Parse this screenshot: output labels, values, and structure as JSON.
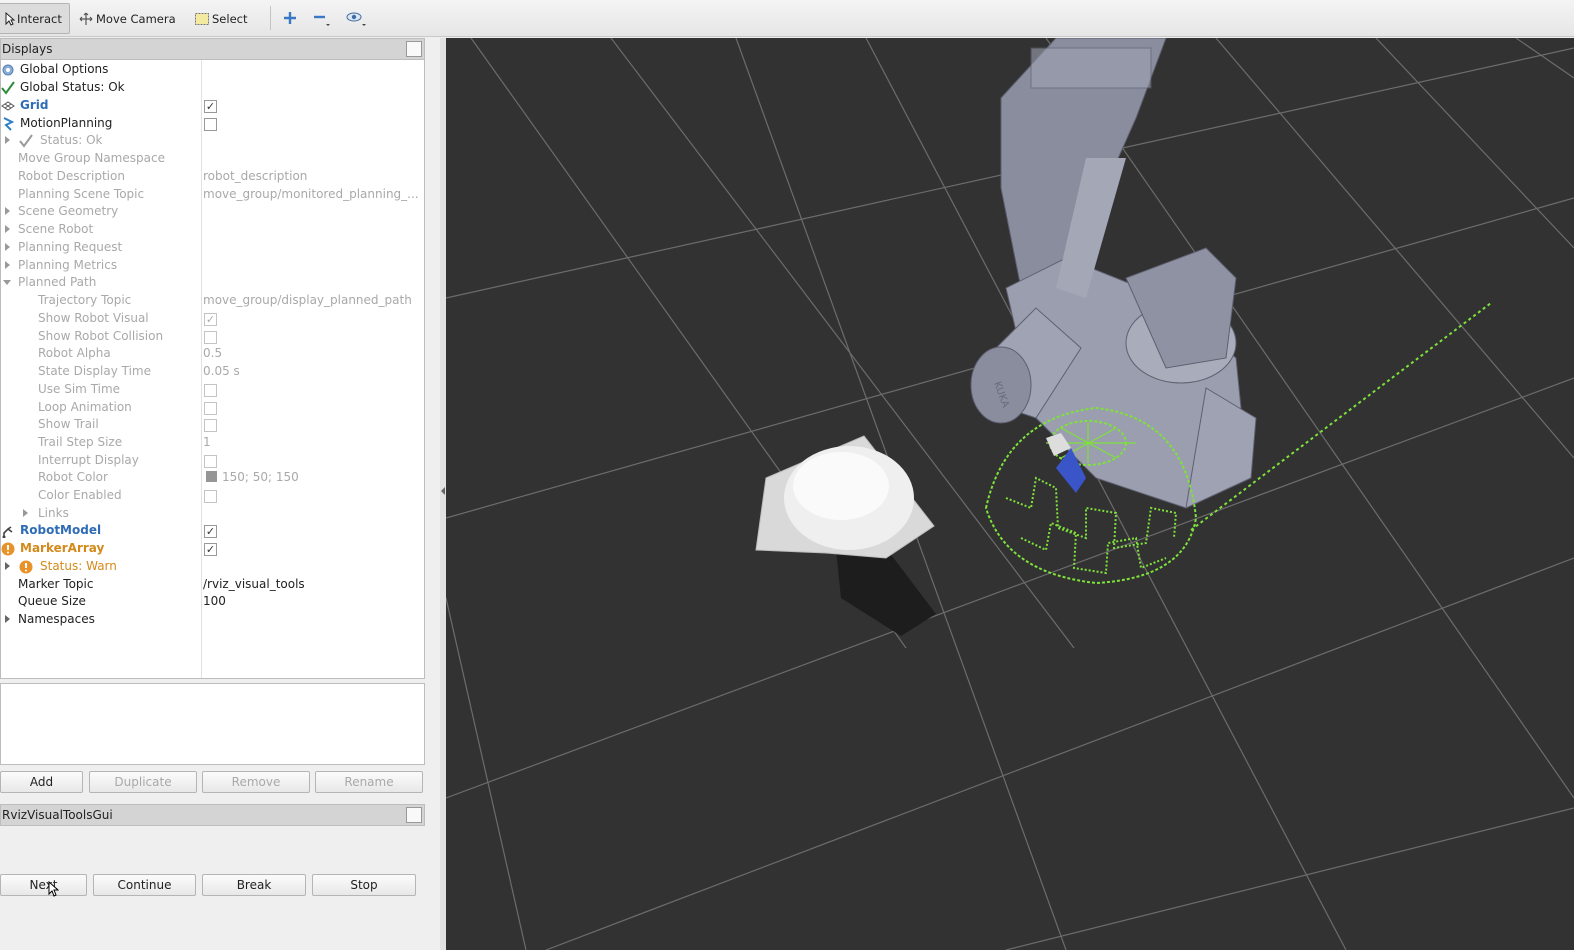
{
  "toolbar": {
    "interact": "Interact",
    "move_camera": "Move Camera",
    "select": "Select",
    "add_icon": "plus-icon",
    "remove_icon": "minus-icon",
    "camera_icon": "eye-icon"
  },
  "displays": {
    "title": "Displays",
    "rows": [
      {
        "label": "Global Options"
      },
      {
        "label": "Global Status: Ok"
      },
      {
        "label": "Grid",
        "checked": true
      },
      {
        "label": "MotionPlanning",
        "checked": false
      },
      {
        "label": "Status: Ok"
      },
      {
        "label": "Move Group Namespace"
      },
      {
        "label": "Robot Description",
        "value": "robot_description"
      },
      {
        "label": "Planning Scene Topic",
        "value": "move_group/monitored_planning_..."
      },
      {
        "label": "Scene Geometry"
      },
      {
        "label": "Scene Robot"
      },
      {
        "label": "Planning Request"
      },
      {
        "label": "Planning Metrics"
      },
      {
        "label": "Planned Path"
      },
      {
        "label": "Trajectory Topic",
        "value": "move_group/display_planned_path"
      },
      {
        "label": "Show Robot Visual",
        "checked": true
      },
      {
        "label": "Show Robot Collision",
        "checked": false
      },
      {
        "label": "Robot Alpha",
        "value": "0.5"
      },
      {
        "label": "State Display Time",
        "value": "0.05 s"
      },
      {
        "label": "Use Sim Time",
        "checked": false
      },
      {
        "label": "Loop Animation",
        "checked": false
      },
      {
        "label": "Show Trail",
        "checked": false
      },
      {
        "label": "Trail Step Size",
        "value": "1"
      },
      {
        "label": "Interrupt Display",
        "checked": false
      },
      {
        "label": "Robot Color",
        "value": "150; 50; 150"
      },
      {
        "label": "Color Enabled",
        "checked": false
      },
      {
        "label": "Links"
      },
      {
        "label": "RobotModel",
        "checked": true
      },
      {
        "label": "MarkerArray",
        "checked": true
      },
      {
        "label": "Status: Warn"
      },
      {
        "label": "Marker Topic",
        "value": "/rviz_visual_tools"
      },
      {
        "label": "Queue Size",
        "value": "100"
      },
      {
        "label": "Namespaces"
      }
    ],
    "buttons": {
      "add": "Add",
      "duplicate": "Duplicate",
      "remove": "Remove",
      "rename": "Rename"
    }
  },
  "rviz_gui": {
    "title": "RvizVisualToolsGui",
    "next": "Next",
    "continue": "Continue",
    "break": "Break",
    "stop": "Stop"
  },
  "colors": {
    "viewport_bg": "#323232",
    "grid_line": "#7a7a7a",
    "marker_green": "#7ee23a",
    "link_blue": "#2f6cb6",
    "warn_orange": "#d48a1a"
  },
  "checkbox_mark": "✓",
  "robot_label": "KUKA"
}
